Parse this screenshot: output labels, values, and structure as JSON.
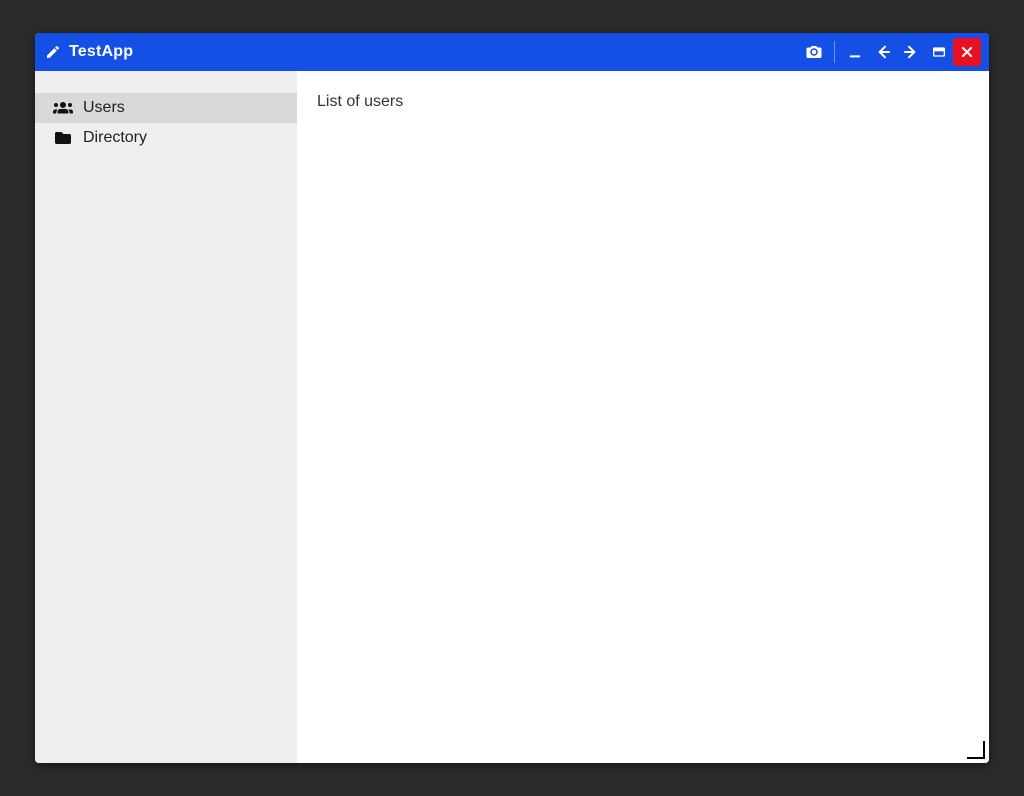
{
  "titlebar": {
    "app_title": "TestApp"
  },
  "sidebar": {
    "items": [
      {
        "label": "Users",
        "icon": "users-icon",
        "active": true
      },
      {
        "label": "Directory",
        "icon": "folder-icon",
        "active": false
      }
    ]
  },
  "main": {
    "heading": "List of users"
  },
  "colors": {
    "titlebar_bg": "#144fe6",
    "close_bg": "#e81123",
    "sidebar_bg": "#efefef",
    "sidebar_active_bg": "#d9d9d9"
  }
}
